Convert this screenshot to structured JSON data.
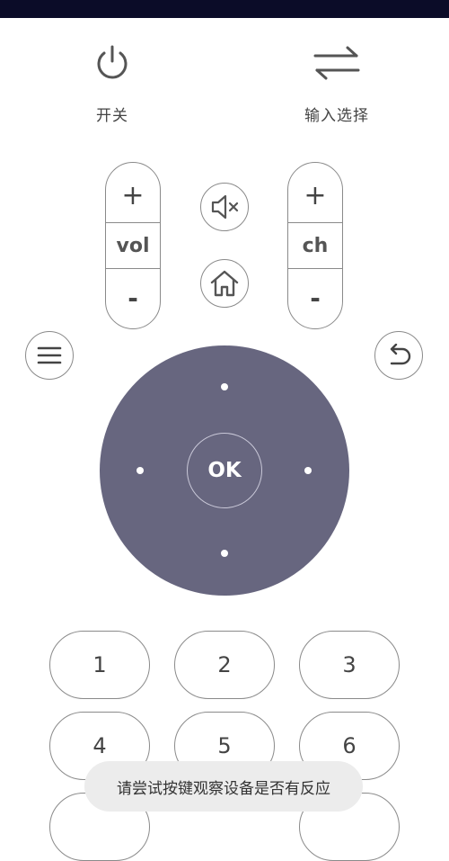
{
  "top_buttons": {
    "power_label": "开关",
    "input_label": "输入选择"
  },
  "volume": {
    "plus": "+",
    "label": "vol",
    "minus": "-"
  },
  "channel": {
    "plus": "+",
    "label": "ch",
    "minus": "-"
  },
  "dpad": {
    "ok_label": "OK"
  },
  "numbers": [
    "1",
    "2",
    "3",
    "4",
    "5",
    "6"
  ],
  "toast": "请尝试按键观察设备是否有反应",
  "colors": {
    "status_bar": "#0b0c28",
    "dpad": "#67667f",
    "border": "#8a8a8a",
    "toast_bg": "#ececec"
  }
}
